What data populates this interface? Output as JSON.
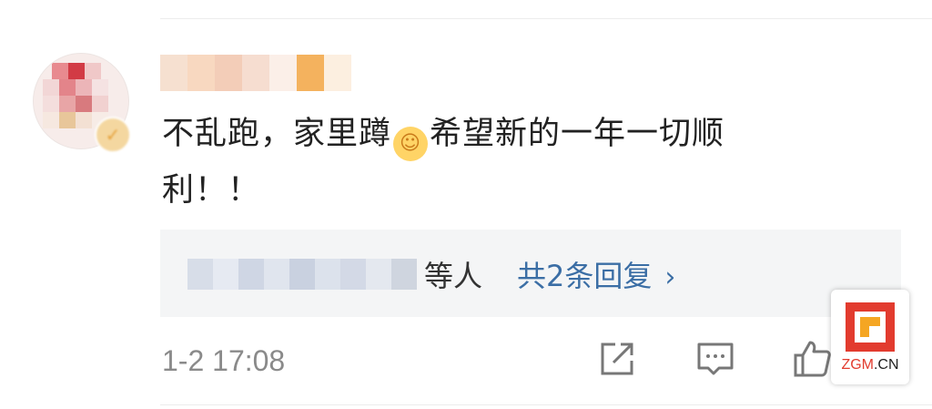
{
  "comment": {
    "text_line1": "不乱跑，家里蹲",
    "emoji": "smiling-hug-emoji",
    "text_line1b": "希望新的一年一切顺",
    "text_line2": "利！！"
  },
  "replies": {
    "suffix": "等人",
    "link_label": "共2条回复",
    "chevron": "›"
  },
  "meta": {
    "timestamp": "1-2 17:08"
  },
  "actions": {
    "share_icon": "share-icon",
    "comment_icon": "comment-icon",
    "like_icon": "like-icon"
  },
  "watermark": {
    "brand": "ZGM",
    "suffix": ".CN"
  },
  "colors": {
    "link": "#3b6ea5",
    "text": "#222222",
    "muted": "#8a8a8a",
    "reply_bg": "#f4f5f6",
    "watermark_red": "#e23b2e",
    "watermark_orange": "#f5a623"
  }
}
